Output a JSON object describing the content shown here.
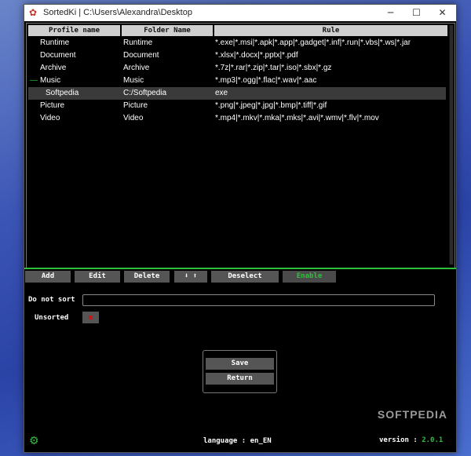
{
  "window": {
    "title": "SortedKi | C:\\Users\\Alexandra\\Desktop",
    "minimize": "─",
    "maximize": "☐",
    "close": "✕"
  },
  "table": {
    "headers": [
      "Profile name",
      "Folder Name",
      "Rule"
    ],
    "rows": [
      {
        "profile": "Runtime",
        "folder": "Runtime",
        "rule": "*.exe|*.msi|*.apk|*.app|*.gadget|*.inf|*.run|*.vbs|*.ws|*.jar",
        "prefix": "",
        "selected": false
      },
      {
        "profile": "Document",
        "folder": "Document",
        "rule": "*.xlsx|*.docx|*.pptx|*.pdf",
        "prefix": "",
        "selected": false
      },
      {
        "profile": "Archive",
        "folder": "Archive",
        "rule": "*.7z|*.rar|*.zip|*.tar|*.iso|*.sbx|*.gz",
        "prefix": "",
        "selected": false
      },
      {
        "profile": "Music",
        "folder": "Music",
        "rule": "*.mp3|*.ogg|*.flac|*.wav|*.aac",
        "prefix": "—",
        "selected": false
      },
      {
        "profile": "Softpedia",
        "folder": "C:/Softpedia",
        "rule": "exe",
        "prefix": "",
        "selected": true
      },
      {
        "profile": "Picture",
        "folder": "Picture",
        "rule": "*.png|*.jpeg|*.jpg|*.bmp|*.tiff|*.gif",
        "prefix": "",
        "selected": false
      },
      {
        "profile": "Video",
        "folder": "Video",
        "rule": "*.mp4|*.mkv|*.mka|*.mks|*.avi|*.wmv|*.flv|*.mov",
        "prefix": "",
        "selected": false
      }
    ]
  },
  "toolbar": {
    "add": "Add",
    "edit": "Edit",
    "delete": "Delete",
    "move": "⬇  ⬆",
    "deselect": "Deselect",
    "enable": "Enable"
  },
  "do_not_sort": {
    "label": "Do not sort",
    "value": ""
  },
  "unsorted": {
    "label": "Unsorted"
  },
  "popup": {
    "save": "Save",
    "return": "Return"
  },
  "footer": {
    "language_label": "language : en_EN",
    "version_label": "version :",
    "version_value": "2.0.1"
  },
  "watermark": "SOFTPEDIA",
  "colors": {
    "accent": "#2fbf3a",
    "unsorted_dot": "#c81818"
  }
}
